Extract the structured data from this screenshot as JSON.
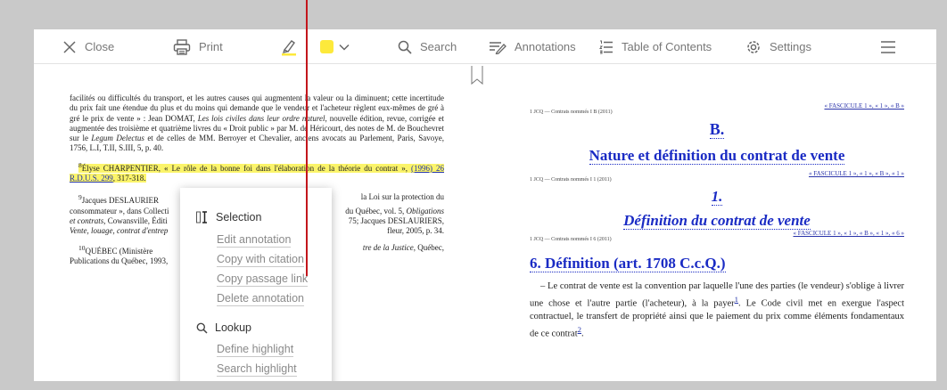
{
  "toolbar": {
    "close_label": "Close",
    "print_label": "Print",
    "search_label": "Search",
    "annotations_label": "Annotations",
    "toc_label": "Table of Contents",
    "settings_label": "Settings",
    "highlight_color": "#fde93b"
  },
  "left_page": {
    "p1_a": "facilités ou difficultés du transport, et les autres causes qui augmentent la valeur ou la diminuent; cette incertitude du prix fait une étendue du plus et du moins qui demande que le vendeur et l'acheteur règlent eux-mêmes de gré à gré le prix de vente » : Jean DOMAT, ",
    "p1_i": "Les lois civiles dans leur ordre naturel",
    "p1_b": ", nouvelle édition, revue, corrigée et augmentée des troisième et quatrième livres du « Droit public » par M. de Héricourt, des notes de M. de Bouchevret sur le ",
    "p1_i2": "Legum Delectus",
    "p1_c": " et de celles de MM. Berroyer et Chevalier, anciens avocats au Parlement, Paris, Savoye, 1756, L.I, T.II, S.III, 5, p. 40.",
    "fn8_num": "8",
    "fn8_text": "Élyse CHARPENTIER, « Le rôle de la bonne foi dans l'élaboration de la théorie du contrat », ",
    "fn8_link": "(1996) 26 R.D.U.S. 299",
    "fn8_end": ", 317-318.",
    "fn9_num": "9",
    "fn9_a": "Jacques DESLAURIER",
    "fn9_r1": "la Loi sur la protection du",
    "fn9_b": "consommateur », dans Collecti",
    "fn9_r2": "du Québec, vol. 5, ",
    "fn9_r2i": "Obligations",
    "fn9_ci": "et contrats",
    "fn9_c": ", Cowansville, Éditi",
    "fn9_r3": "75; Jacques DESLAURIERS,",
    "fn9_di": "Vente, louage, contrat d'entrep",
    "fn9_r4": "fleur, 2005, p. 34.",
    "fn10_num": "10",
    "fn10_a": "QUÉBEC (Ministère",
    "fn10_ri": "tre de la Justice",
    "fn10_r": ", Québec,",
    "fn10_b": "Publications du Québec, 1993,"
  },
  "right_page": {
    "xref1": "« FASCICULE 1 », « 1 », « B »",
    "head1": "1 JCQ — Contrats nommés I B (2011)",
    "title_b": "B.",
    "title_nature": "Nature et définition du contrat de vente",
    "xref2": "« FASCICULE 1 », « 1 », « B », « 1 »",
    "head2": "1 JCQ — Contrats nommés I 1 (2011)",
    "title_1": "1.",
    "title_def": "Définition du contrat de vente",
    "xref3": "« FASCICULE 1 », « 1 », « B », « 1 », « 6 »",
    "head3": "1 JCQ — Contrats nommés I 6 (2011)",
    "title_6": "6. Définition (art. 1708 C.c.Q.)",
    "body_a": "– Le contrat de vente est la convention par laquelle l'une des parties (le vendeur) s'oblige à livrer une chose et l'autre partie (l'acheteur), à la payer",
    "body_sup1": "1",
    "body_b": ". Le Code civil met en exergue l'aspect contractuel, le transfert de propriété ainsi que le paiement du prix comme éléments fondamentaux de ce contrat",
    "body_sup2": "2",
    "body_c": "."
  },
  "context_menu": {
    "selection_label": "Selection",
    "edit_annotation": "Edit annotation",
    "copy_with_citation": "Copy with citation",
    "copy_passage_link": "Copy passage link",
    "delete_annotation": "Delete annotation",
    "lookup_label": "Lookup",
    "define_highlight": "Define highlight",
    "search_highlight": "Search highlight"
  }
}
